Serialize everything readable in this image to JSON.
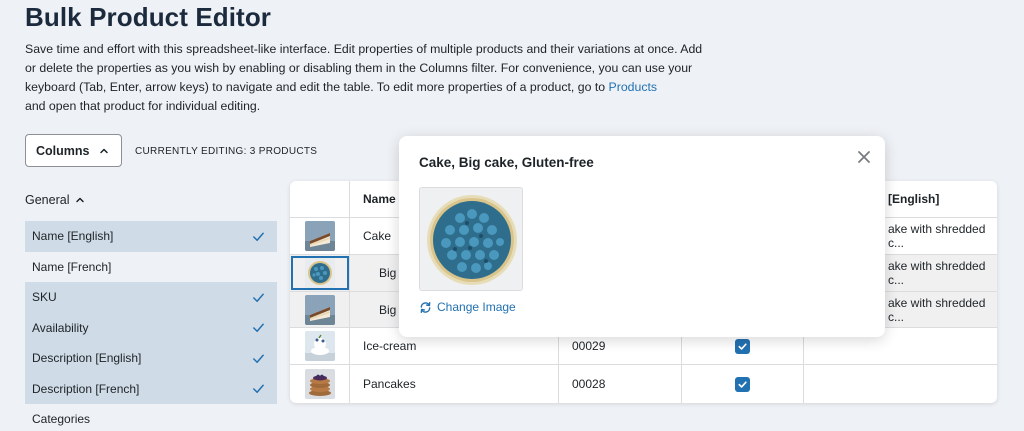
{
  "page": {
    "title": "Bulk Product Editor",
    "intro_text": "Save time and effort with this spreadsheet-like interface. Edit properties of multiple products and their variations at once. Add or delete the properties as you wish by enabling or disabling them in the Columns filter. For convenience, you can use your keyboard (Tab, Enter, arrow keys) to navigate and edit the table. To edit more properties of a product, go to",
    "intro_link": "Products",
    "intro_tail": "and open that product for individual editing."
  },
  "toolbar": {
    "columns_label": "Columns",
    "editing_label": "CURRENTLY EDITING: 3 PRODUCTS"
  },
  "columns_panel": {
    "group_label": "General",
    "items": [
      {
        "label": "Name [English]",
        "enabled": true
      },
      {
        "label": "Name [French]",
        "enabled": false
      },
      {
        "label": "SKU",
        "enabled": true
      },
      {
        "label": "Availability",
        "enabled": true
      },
      {
        "label": "Description [English]",
        "enabled": true
      },
      {
        "label": "Description [French]",
        "enabled": true
      },
      {
        "label": "Categories",
        "enabled": false
      }
    ]
  },
  "table": {
    "headers": {
      "name": "Name",
      "description": "[English]"
    },
    "rows": [
      {
        "name": "Cake",
        "sku": "",
        "available": null,
        "description": "ake with shredded c..."
      },
      {
        "name": "Big",
        "sku": "",
        "available": null,
        "description": "ake with shredded c..."
      },
      {
        "name": "Big",
        "sku": "",
        "available": null,
        "description": "ake with shredded c..."
      },
      {
        "name": "Ice-cream",
        "sku": "00029",
        "available": true,
        "description": ""
      },
      {
        "name": "Pancakes",
        "sku": "00028",
        "available": true,
        "description": ""
      }
    ]
  },
  "popover": {
    "title": "Cake, Big cake, Gluten-free",
    "change_image_label": "Change Image"
  },
  "colors": {
    "accent": "#2271b1",
    "title": "#1b2a3d",
    "enabled_row_bg": "#cfdbe6",
    "page_bg": "#eef1f5"
  }
}
